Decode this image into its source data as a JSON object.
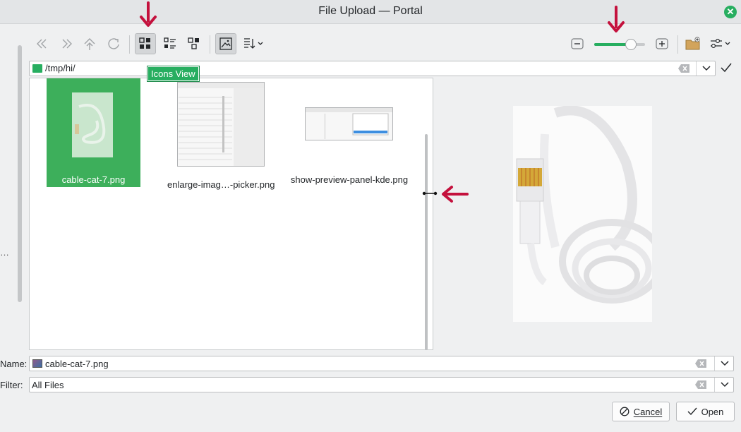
{
  "window": {
    "title": "File Upload — Portal"
  },
  "toolbar": {
    "buttons": [
      {
        "name": "back-icon"
      },
      {
        "name": "forward-icon"
      },
      {
        "name": "up-icon"
      },
      {
        "name": "reload-icon"
      },
      {
        "name": "icons-view-icon",
        "pressed": true
      },
      {
        "name": "detailed-view-icon"
      },
      {
        "name": "tree-view-icon"
      },
      {
        "name": "preview-toggle-icon",
        "pressed": true
      },
      {
        "name": "sort-icon"
      }
    ],
    "zoom_level": 0.72,
    "tooltip": "Icons View"
  },
  "location": {
    "path": "/tmp/hi/"
  },
  "files": [
    {
      "name": "cable-cat-7.png",
      "selected": true
    },
    {
      "name": "enlarge-imag…-picker.png",
      "selected": false
    },
    {
      "name": "show-preview-panel-kde.png",
      "selected": false
    }
  ],
  "bottom": {
    "name_label": "Name:",
    "name_value": "cable-cat-7.png",
    "filter_label": "Filter:",
    "filter_value": "All Files",
    "cancel_label": "Cancel",
    "open_label": "Open"
  },
  "sidebar": {
    "ellipsis": "…"
  },
  "colors": {
    "accent": "#27ae60",
    "annotation": "#c4113d"
  }
}
